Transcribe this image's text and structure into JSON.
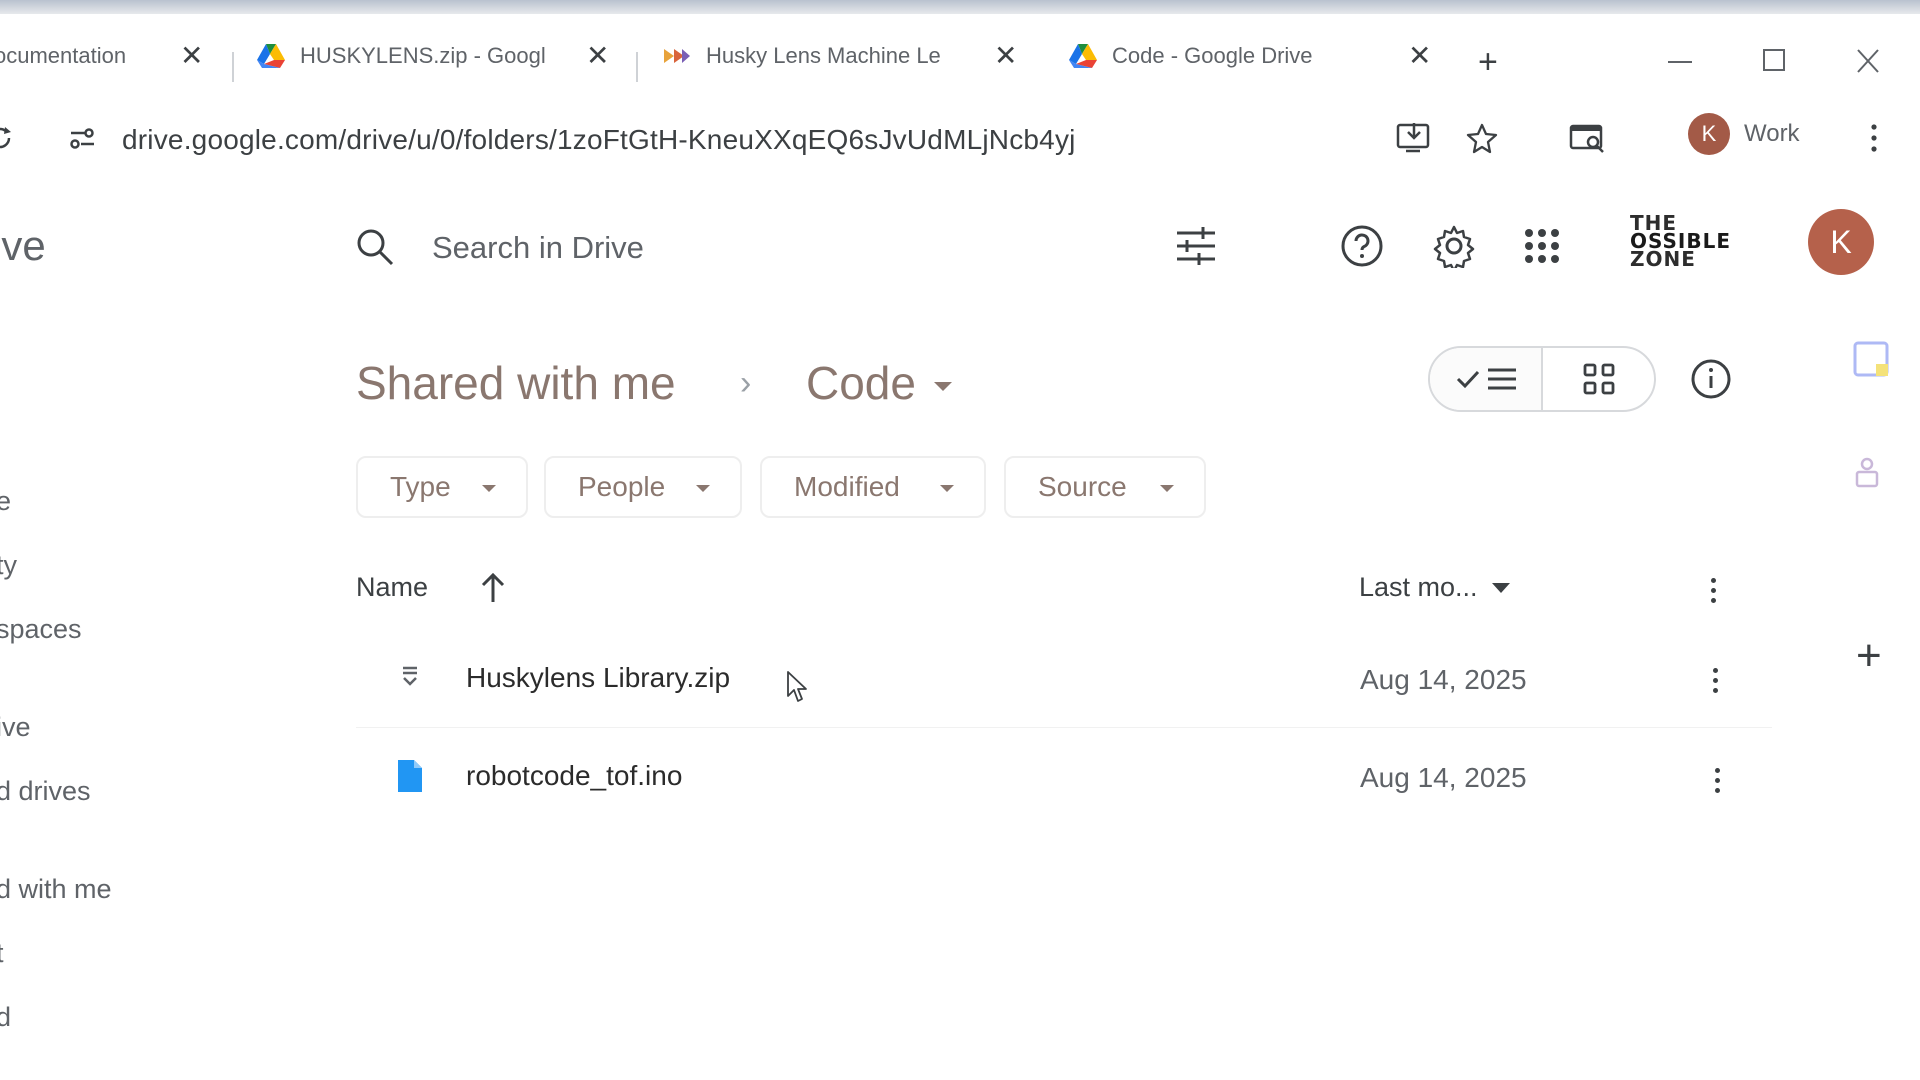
{
  "browser": {
    "tabs": [
      {
        "title": "ocumentation",
        "favicon": "doc-icon"
      },
      {
        "title": "HUSKYLENS.zip - Googl",
        "favicon": "google-drive-icon"
      },
      {
        "title": "Husky Lens Machine Le",
        "favicon": "play-icon"
      },
      {
        "title": "Code - Google Drive",
        "favicon": "google-drive-icon",
        "active": true
      }
    ],
    "new_tab": "+",
    "window_controls": {
      "minimize": "—",
      "maximize": "☐",
      "close": "✕"
    },
    "url": "drive.google.com/drive/u/0/folders/1zoFtGtH-KneuXXqEQ6sJvUdMLjNcb4yj",
    "profile": {
      "initial": "K",
      "label": "Work"
    }
  },
  "drive": {
    "logo_fragment": "ive",
    "search_placeholder": "Search in Drive",
    "brand_logo_lines": [
      "THE",
      "OSSIBLE",
      "ZONE"
    ],
    "account_initial": "K",
    "sidebar": [
      "e",
      "ty",
      "spaces",
      "ive",
      "d drives",
      "d with me",
      "t",
      "d"
    ],
    "breadcrumb": {
      "parent": "Shared with me",
      "separator": "›",
      "current": "Code"
    },
    "filters": [
      "Type",
      "People",
      "Modified",
      "Source"
    ],
    "columns": {
      "name": "Name",
      "modified": "Last mo..."
    },
    "files": [
      {
        "name": "Huskylens Library.zip",
        "modified": "Aug 14, 2025",
        "type": "zip"
      },
      {
        "name": "robotcode_tof.ino",
        "modified": "Aug 14, 2025",
        "type": "document"
      }
    ],
    "right_panel": {
      "add": "+"
    }
  },
  "colors": {
    "breadcrumb": "#8a776f",
    "avatar": "#b5614b",
    "file_doc_icon": "#2196f3"
  }
}
